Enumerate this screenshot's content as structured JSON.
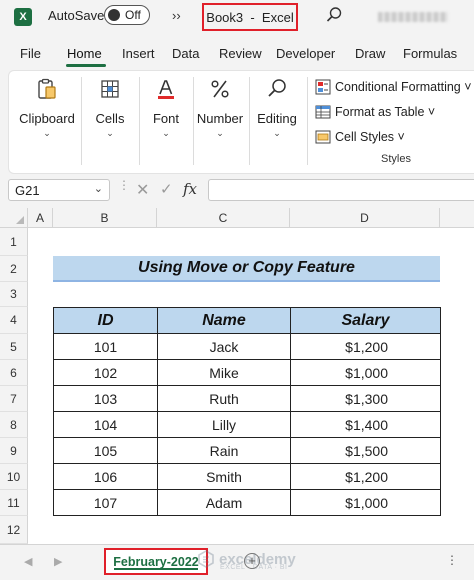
{
  "titlebar": {
    "app_logo": "X",
    "autosave_label": "AutoSave",
    "autosave_state": "Off",
    "more_commands": "››",
    "document_title": "Book3  -  Excel"
  },
  "tabs": [
    "File",
    "Home",
    "Insert",
    "Data",
    "Review",
    "Developer",
    "Draw",
    "Formulas"
  ],
  "active_tab": "Home",
  "ribbon": {
    "groups": [
      {
        "label": "Clipboard",
        "icon": "clipboard-icon"
      },
      {
        "label": "Cells",
        "icon": "cells-icon"
      },
      {
        "label": "Font",
        "icon": "font-icon"
      },
      {
        "label": "Number",
        "icon": "percent-icon"
      },
      {
        "label": "Editing",
        "icon": "search-icon"
      }
    ],
    "styles": {
      "conditional_formatting": "Conditional Formatting ˅",
      "format_as_table": "Format as Table ˅",
      "cell_styles": "Cell Styles ˅",
      "caption": "Styles"
    }
  },
  "formula_bar": {
    "name_box": "G21",
    "fx": "fx",
    "cancel": "✕",
    "enter": "✓",
    "content": ""
  },
  "grid": {
    "columns": [
      "A",
      "B",
      "C",
      "D"
    ],
    "rows": [
      "1",
      "2",
      "3",
      "4",
      "5",
      "6",
      "7",
      "8",
      "9",
      "10",
      "11",
      "12"
    ],
    "banner": "Using Move or Copy Feature",
    "table": {
      "headers": [
        "ID",
        "Name",
        "Salary"
      ],
      "rows": [
        [
          "101",
          "Jack",
          "$1,200"
        ],
        [
          "102",
          "Mike",
          "$1,000"
        ],
        [
          "103",
          "Ruth",
          "$1,300"
        ],
        [
          "104",
          "Lilly",
          "$1,400"
        ],
        [
          "105",
          "Rain",
          "$1,500"
        ],
        [
          "106",
          "Smith",
          "$1,200"
        ],
        [
          "107",
          "Adam",
          "$1,000"
        ]
      ]
    }
  },
  "sheets": {
    "active_sheet": "February-2022",
    "watermark_name": "exceldemy",
    "watermark_tagline": "EXCEL · DATA · BI"
  },
  "colors": {
    "accent": "#1d6f42",
    "highlight_border": "#e0202a",
    "header_fill": "#bdd7ee"
  }
}
